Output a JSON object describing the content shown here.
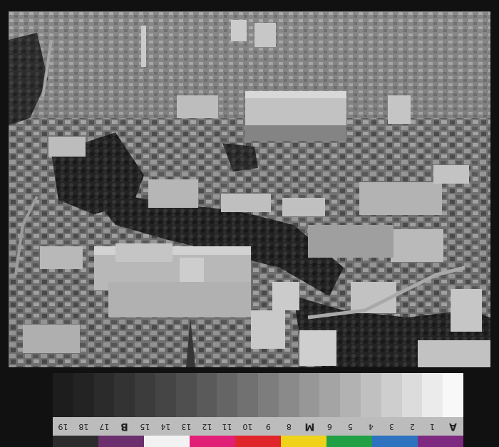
{
  "scale_card": {
    "gray_levels": [
      "#1d1d1d",
      "#232323",
      "#2b2b2b",
      "#333333",
      "#3c3c3c",
      "#454545",
      "#4f4f4f",
      "#5a5a5a",
      "#656565",
      "#717171",
      "#7d7d7d",
      "#8a8a8a",
      "#979797",
      "#a4a4a4",
      "#b2b2b2",
      "#c0c0c0",
      "#cecece",
      "#dcdcdc",
      "#ebebeb",
      "#f8f8f8"
    ],
    "labels": [
      "19",
      "18",
      "17",
      "B",
      "15",
      "14",
      "13",
      "12",
      "11",
      "10",
      "9",
      "8",
      "M",
      "6",
      "5",
      "4",
      "3",
      "2",
      "1",
      "A"
    ],
    "bold_labels": [
      "B",
      "M",
      "A"
    ],
    "colors": [
      "#2c2c2c",
      "#6b2f6d",
      "#f2f2f2",
      "#e21f76",
      "#e0252b",
      "#f0d21a",
      "#22a045",
      "#2d73bf",
      "#7d2a80"
    ]
  }
}
